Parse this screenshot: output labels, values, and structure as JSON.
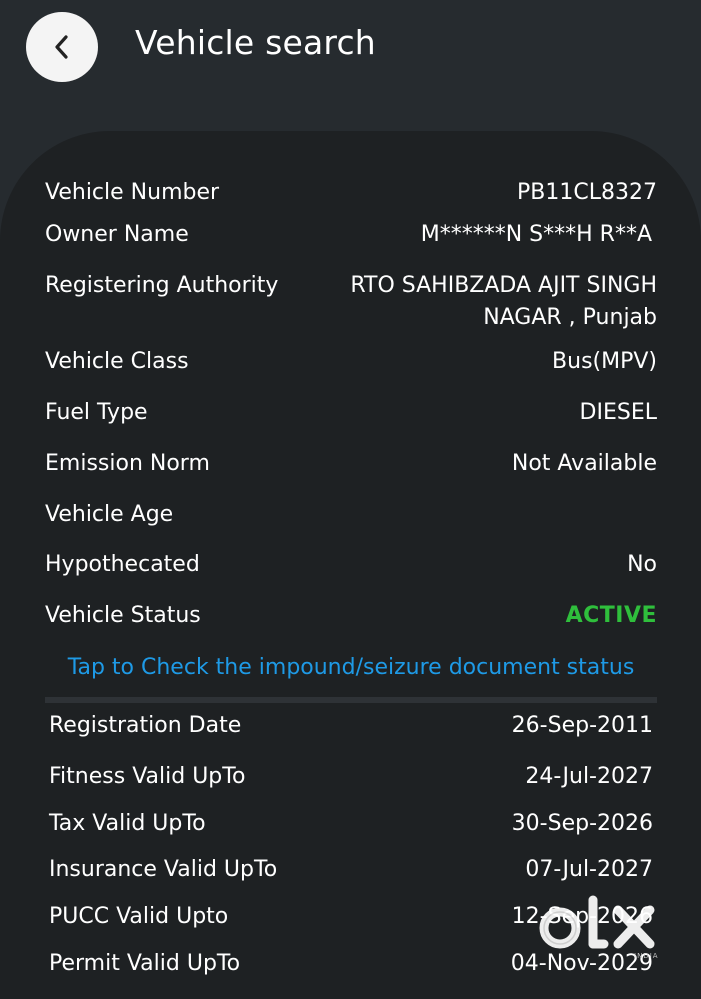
{
  "header": {
    "title": "Vehicle search"
  },
  "details": [
    {
      "label": "Vehicle Number",
      "value": "PB11CL8327"
    },
    {
      "label": "Owner Name",
      "value": "M******N S***H R**A"
    },
    {
      "label": "Registering Authority",
      "value": "RTO SAHIBZADA AJIT SINGH NAGAR , Punjab"
    },
    {
      "label": "Vehicle Class",
      "value": "Bus(MPV)"
    },
    {
      "label": "Fuel Type",
      "value": "DIESEL"
    },
    {
      "label": "Emission Norm",
      "value": "Not Available"
    },
    {
      "label": "Vehicle Age",
      "value": ""
    },
    {
      "label": "Hypothecated",
      "value": "No"
    },
    {
      "label": "Vehicle Status",
      "value": "ACTIVE"
    }
  ],
  "impound_link": "Tap to Check the impound/seizure document status",
  "validity": [
    {
      "label": "Registration Date",
      "value": "26-Sep-2011"
    },
    {
      "label": "Fitness Valid UpTo",
      "value": "24-Jul-2027"
    },
    {
      "label": "Tax Valid UpTo",
      "value": "30-Sep-2026"
    },
    {
      "label": "Insurance Valid UpTo",
      "value": "07-Jul-2027"
    },
    {
      "label": "PUCC Valid Upto",
      "value": "12-Sep-2026"
    },
    {
      "label": "Permit Valid UpTo",
      "value": "04-Nov-2029"
    }
  ],
  "colors": {
    "background": "#262b2f",
    "card": "#1e2123",
    "active_status": "#2fbf3c",
    "link": "#1e9ae6"
  },
  "watermark": {
    "text": "olx",
    "sub": "INDIA"
  }
}
